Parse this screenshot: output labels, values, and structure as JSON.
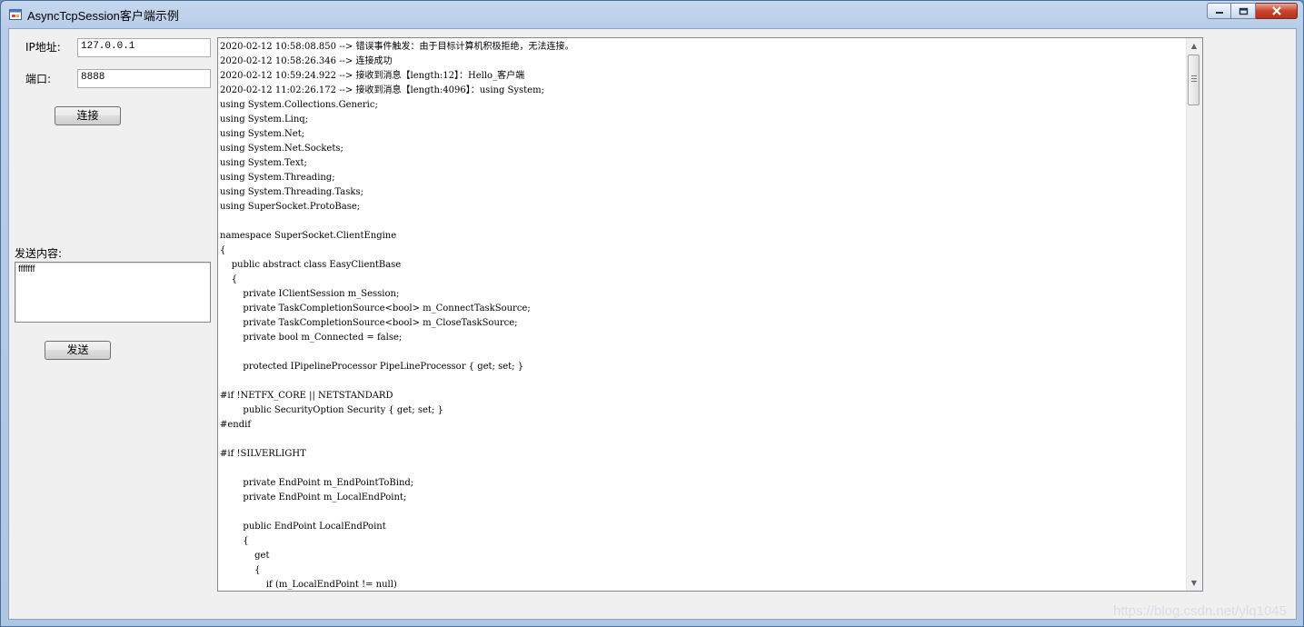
{
  "window": {
    "title": "AsyncTcpSession客户端示例",
    "controls": {
      "minimize": "minimize",
      "maximize": "maximize",
      "close": "close"
    }
  },
  "form": {
    "ip_label": "IP地址:",
    "ip_value": "127.0.0.1",
    "port_label": "端口:",
    "port_value": "8888",
    "connect_button": "连接",
    "send_label": "发送内容:",
    "send_value": "fffffff",
    "send_button": "发送"
  },
  "log": {
    "lines": [
      "2020-02-12 10:58:08.850 --> 错误事件触发：由于目标计算机积极拒绝，无法连接。",
      "2020-02-12 10:58:26.346 --> 连接成功",
      "2020-02-12 10:59:24.922 --> 接收到消息【length:12】：Hello_客户端",
      "2020-02-12 11:02:26.172 --> 接收到消息【length:4096】：using System;",
      "using System.Collections.Generic;",
      "using System.Linq;",
      "using System.Net;",
      "using System.Net.Sockets;",
      "using System.Text;",
      "using System.Threading;",
      "using System.Threading.Tasks;",
      "using SuperSocket.ProtoBase;",
      "",
      "namespace SuperSocket.ClientEngine",
      "{",
      "    public abstract class EasyClientBase",
      "    {",
      "        private IClientSession m_Session;",
      "        private TaskCompletionSource<bool> m_ConnectTaskSource;",
      "        private TaskCompletionSource<bool> m_CloseTaskSource;",
      "        private bool m_Connected = false;",
      "",
      "        protected IPipelineProcessor PipeLineProcessor { get; set; }",
      "",
      "#if !NETFX_CORE || NETSTANDARD",
      "        public SecurityOption Security { get; set; }",
      "#endif",
      "",
      "#if !SILVERLIGHT",
      "",
      "        private EndPoint m_EndPointToBind;",
      "        private EndPoint m_LocalEndPoint;",
      "",
      "        public EndPoint LocalEndPoint",
      "        {",
      "            get",
      "            {",
      "                if (m_LocalEndPoint != null)"
    ],
    "scroll_position": 0.0
  },
  "watermark": "https://blog.csdn.net/ylq1045"
}
